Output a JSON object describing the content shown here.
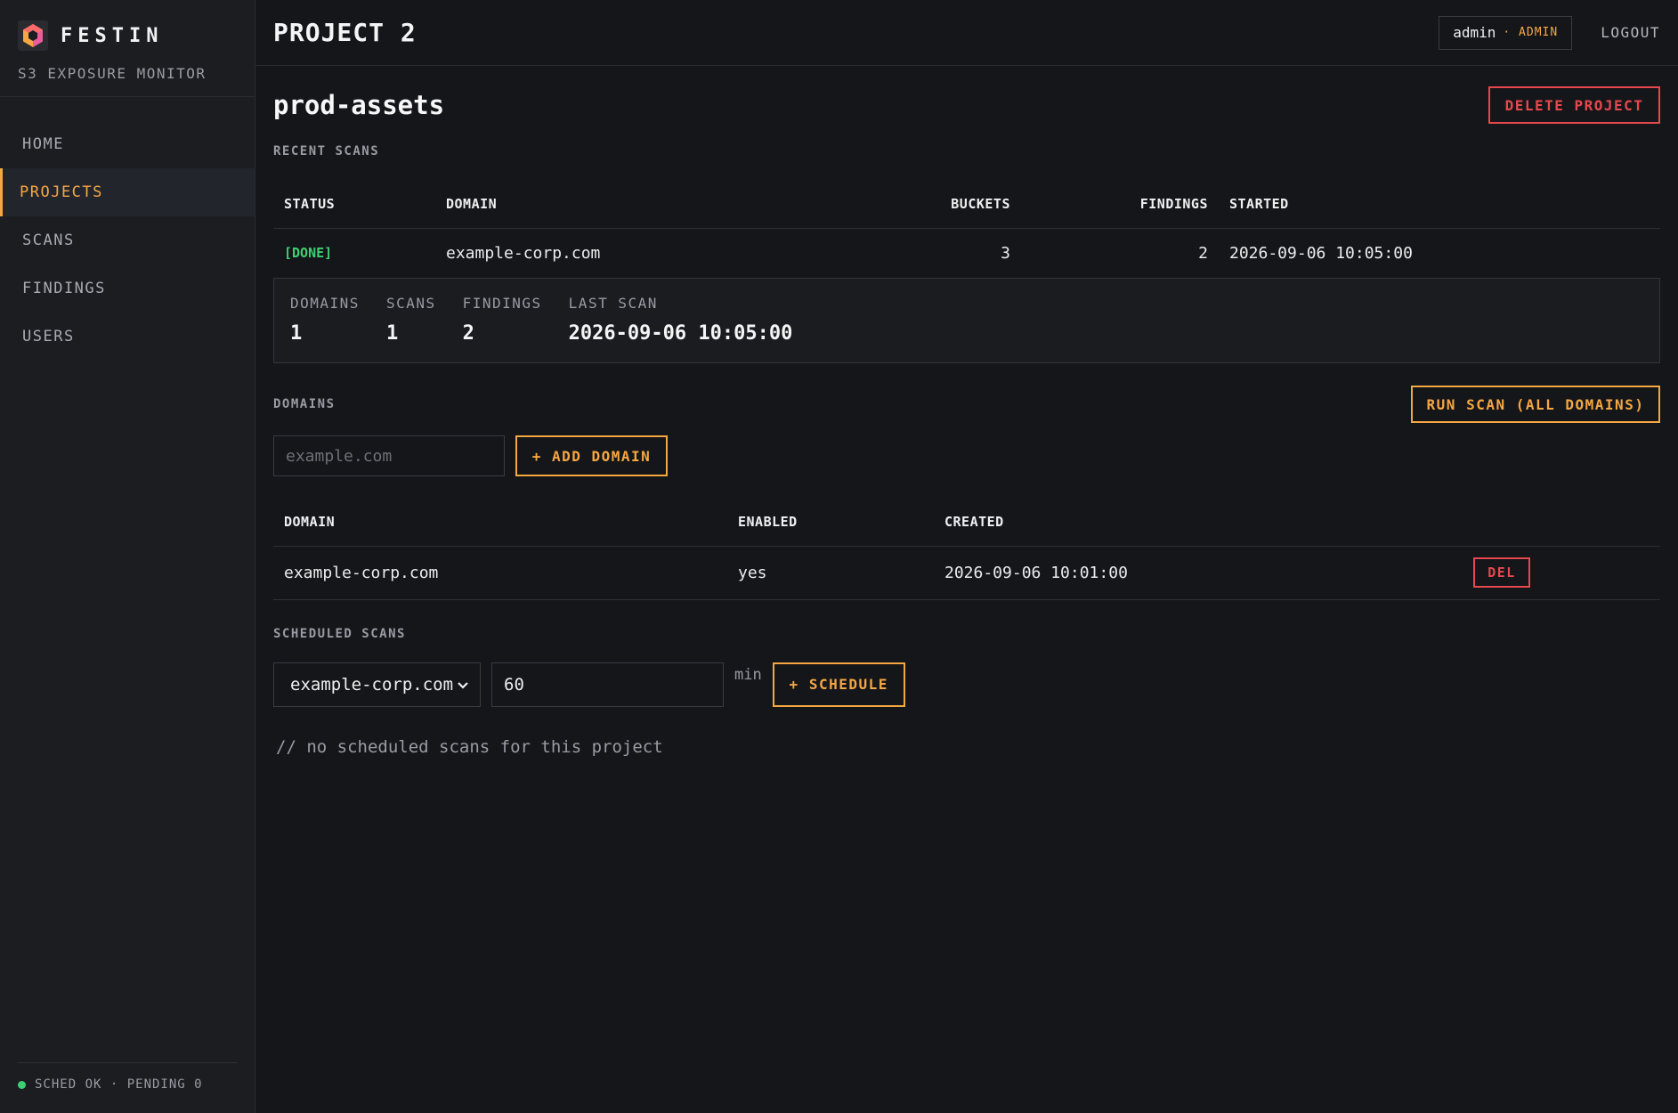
{
  "brand": {
    "name": "FESTIN",
    "subtitle": "S3 EXPOSURE MONITOR"
  },
  "nav": [
    {
      "label": "HOME",
      "active": false
    },
    {
      "label": "PROJECTS",
      "active": true
    },
    {
      "label": "SCANS",
      "active": false
    },
    {
      "label": "FINDINGS",
      "active": false
    },
    {
      "label": "USERS",
      "active": false
    }
  ],
  "footer": {
    "status": "SCHED OK · PENDING 0"
  },
  "header": {
    "title": "PROJECT 2",
    "user": "admin",
    "role": "· ADMIN",
    "logout": "LOGOUT"
  },
  "project": {
    "name": "prod-assets",
    "delete_label": "DELETE PROJECT"
  },
  "recent_scans": {
    "label": "RECENT SCANS",
    "columns": [
      "STATUS",
      "DOMAIN",
      "BUCKETS",
      "FINDINGS",
      "STARTED"
    ],
    "rows": [
      {
        "status": "[DONE]",
        "domain": "example-corp.com",
        "buckets": "3",
        "findings": "2",
        "started": "2026-09-06 10:05:00"
      }
    ]
  },
  "stats": [
    {
      "label": "DOMAINS",
      "value": "1"
    },
    {
      "label": "SCANS",
      "value": "1"
    },
    {
      "label": "FINDINGS",
      "value": "2"
    },
    {
      "label": "LAST SCAN",
      "value": "2026-09-06 10:05:00"
    }
  ],
  "domains": {
    "label": "DOMAINS",
    "run_scan_label": "RUN SCAN (ALL DOMAINS)",
    "input_placeholder": "example.com",
    "add_label": "+ ADD DOMAIN",
    "columns": [
      "DOMAIN",
      "ENABLED",
      "CREATED"
    ],
    "rows": [
      {
        "domain": "example-corp.com",
        "enabled": "yes",
        "created": "2026-09-06 10:01:00",
        "del_label": "DEL"
      }
    ]
  },
  "scheduled": {
    "label": "SCHEDULED SCANS",
    "selected_domain": "example-corp.com",
    "interval_value": "60",
    "unit": "min",
    "add_label": "+ SCHEDULE",
    "empty": "// no scheduled scans for this project"
  },
  "colors": {
    "accent": "#f5a742",
    "danger": "#e5484d",
    "ok": "#3ecf74",
    "bg": "#15161a",
    "sidebar": "#1c1d21"
  }
}
